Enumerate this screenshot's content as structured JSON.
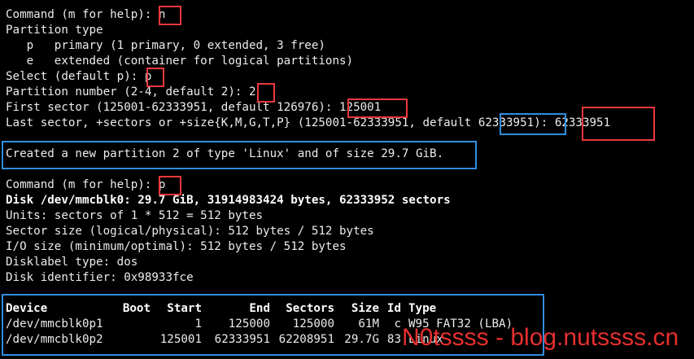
{
  "terminal": {
    "section1": {
      "prompt": "Command (m for help): ",
      "input": "n",
      "partition_type": "Partition type",
      "option_p": "   p   primary (1 primary, 0 extended, 3 free)",
      "option_e": "   e   extended (container for logical partitions)",
      "select_prompt": "Select (default p): ",
      "select_input": "p",
      "number_prompt": "Partition number (2-4, default 2): ",
      "number_input": "2",
      "first_prompt": "First sector (125001-62333951, default 126976): ",
      "first_input": "125001",
      "last_prompt": "Last sector, +sectors or +size{K,M,G,T,P} (125001-62333951, default ",
      "last_default": "62333951",
      "last_sep": "): ",
      "last_input": "62333951",
      "created": "Created a new partition 2 of type 'Linux' and of size 29.7 GiB."
    },
    "section2": {
      "prompt": "Command (m for help): ",
      "input": "p",
      "disk_header": "Disk /dev/mmcblk0: 29.7 GiB, 31914983424 bytes, 62333952 sectors",
      "units": "Units: sectors of 1 * 512 = 512 bytes",
      "sector_size": "Sector size (logical/physical): 512 bytes / 512 bytes",
      "io_size": "I/O size (minimum/optimal): 512 bytes / 512 bytes",
      "disklabel": "Disklabel type: dos",
      "identifier": "Disk identifier: 0x98933fce"
    },
    "table": {
      "headers": [
        "Device",
        "Boot",
        "Start",
        "End",
        "Sectors",
        "Size",
        "Id",
        "Type"
      ],
      "rows": [
        [
          "/dev/mmcblk0p1",
          "",
          "1",
          "125000",
          "125000",
          "61M",
          "c",
          "W95 FAT32 (LBA)"
        ],
        [
          "/dev/mmcblk0p2",
          "",
          "125001",
          "62333951",
          "62208951",
          "29.7G",
          "83",
          "Linux"
        ]
      ]
    }
  },
  "watermark": "N0tssss - blog.nutssss.cn",
  "colors": {
    "background": "#000000",
    "text": "#ececec",
    "red_highlight": "#e8383d",
    "blue_highlight": "#2f8ee0",
    "watermark": "#e62f2f"
  }
}
